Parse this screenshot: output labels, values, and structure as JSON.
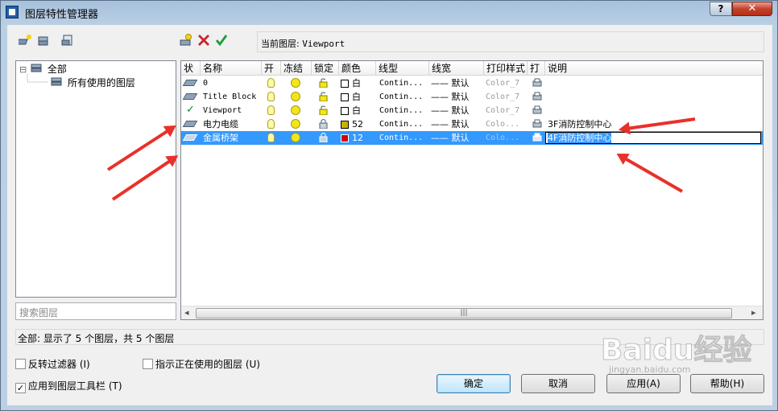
{
  "window": {
    "title": "图层特性管理器",
    "help_label": "?",
    "close_label": "✕"
  },
  "toolbar": {
    "current_layer_label": "当前图层:",
    "current_layer_value": "Viewport"
  },
  "tree": {
    "root": "全部",
    "child": "所有使用的图层",
    "expand_glyph": "⊟"
  },
  "search": {
    "placeholder": "搜索图层"
  },
  "grid": {
    "headers": [
      "状",
      "名称",
      "开",
      "冻结",
      "锁定",
      "颜色",
      "线型",
      "线宽",
      "打印样式",
      "打",
      "说明"
    ],
    "rows": [
      {
        "status": "layer",
        "name": "0",
        "color_name": "白",
        "color": "#ffffff",
        "linetype": "Contin...",
        "lineweight": "—— 默认",
        "plotstyle": "Color_7",
        "desc": ""
      },
      {
        "status": "layer",
        "name": "Title Block",
        "color_name": "白",
        "color": "#ffffff",
        "linetype": "Contin...",
        "lineweight": "—— 默认",
        "plotstyle": "Color_7",
        "desc": ""
      },
      {
        "status": "current",
        "name": "Viewport",
        "color_name": "白",
        "color": "#ffffff",
        "linetype": "Contin...",
        "lineweight": "—— 默认",
        "plotstyle": "Color_7",
        "desc": ""
      },
      {
        "status": "layer",
        "name": "电力电缆",
        "color_name": "52",
        "color": "#c8b400",
        "linetype": "Contin...",
        "lineweight": "—— 默认",
        "plotstyle": "Colo...",
        "desc": "3F消防控制中心"
      },
      {
        "status": "layer",
        "name": "金属桥架",
        "color_name": "12",
        "color": "#d40000",
        "linetype": "Contin...",
        "lineweight": "—— 默认",
        "plotstyle": "Colo...",
        "desc": "4F消防控制中心"
      }
    ],
    "scroll_left": "◂",
    "scroll_right": "▸",
    "scroll_grip": "|||"
  },
  "status": "全部: 显示了 5 个图层，共 5 个图层",
  "options": {
    "invert_filter": "反转过滤器 (I)",
    "show_in_use": "指示正在使用的图层 (U)",
    "apply_toolbar": "应用到图层工具栏 (T)",
    "apply_toolbar_checked": "✓"
  },
  "buttons": {
    "ok": "确定",
    "cancel": "取消",
    "apply": "应用(A)",
    "help": "帮助(H)"
  },
  "watermark": {
    "main": "Baidu经验",
    "sub": "jingyan.baidu.com"
  },
  "colors": {
    "selection": "#3399ff",
    "annotation_arrow": "#e8312a"
  }
}
